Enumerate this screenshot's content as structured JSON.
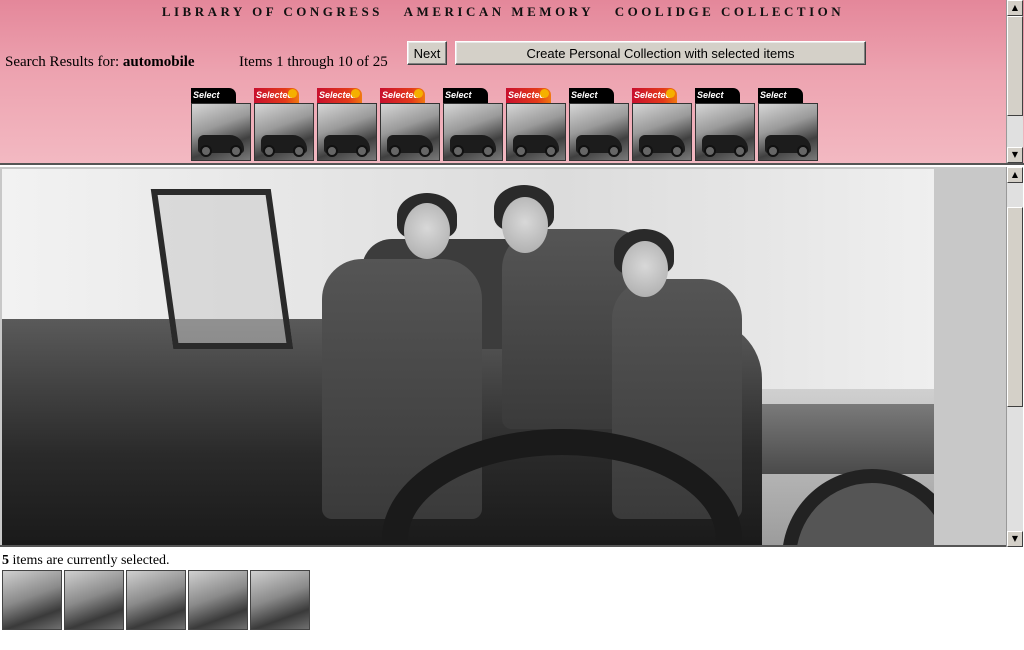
{
  "header": {
    "banner": [
      "LIBRARY OF CONGRESS",
      "AMERICAN MEMORY",
      "COOLIDGE COLLECTION"
    ],
    "search_prefix": "Search Results for:",
    "search_term": "automobile",
    "items_range": "Items 1 through 10 of 25",
    "next_button": "Next",
    "create_button": "Create Personal Collection with selected items"
  },
  "thumbnails": [
    {
      "label": "Select",
      "selected": false
    },
    {
      "label": "Selected",
      "selected": true
    },
    {
      "label": "Selected",
      "selected": true
    },
    {
      "label": "Selected",
      "selected": true
    },
    {
      "label": "Select",
      "selected": false
    },
    {
      "label": "Selected",
      "selected": true
    },
    {
      "label": "Select",
      "selected": false
    },
    {
      "label": "Selected",
      "selected": true
    },
    {
      "label": "Select",
      "selected": false
    },
    {
      "label": "Select",
      "selected": false
    }
  ],
  "selection": {
    "count": "5",
    "suffix": "items are currently selected."
  },
  "colors": {
    "header_bg_top": "#e4879a",
    "header_bg_bottom": "#f3b9c2",
    "selected_tag": "#c8102e",
    "unselected_tag": "#000000",
    "button_face": "#d4d0c8"
  },
  "icons": {
    "scroll_up": "▲",
    "scroll_down": "▼"
  }
}
